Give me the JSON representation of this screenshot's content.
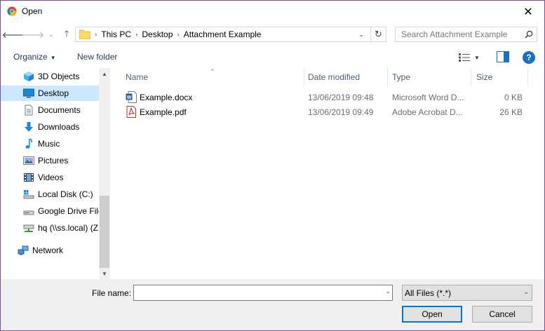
{
  "window": {
    "title": "Open",
    "close_glyph": "✕"
  },
  "nav_buttons": {
    "back": "🡐",
    "forward": "🡒",
    "recent": "⌄",
    "up": "🡑"
  },
  "address": {
    "crumbs": [
      "This PC",
      "Desktop",
      "Attachment Example"
    ],
    "separator": "›",
    "dropdown_glyph": "⌄",
    "refresh_glyph": "↻"
  },
  "search": {
    "placeholder": "Search Attachment Example"
  },
  "commands": {
    "organize": "Organize",
    "caret": "▼",
    "new_folder": "New folder",
    "view_caret": "▼",
    "help": "?"
  },
  "nav_pane": {
    "items": [
      {
        "label": "3D Objects",
        "icon": "3d-objects-icon"
      },
      {
        "label": "Desktop",
        "icon": "desktop-icon",
        "selected": true
      },
      {
        "label": "Documents",
        "icon": "documents-icon"
      },
      {
        "label": "Downloads",
        "icon": "downloads-icon"
      },
      {
        "label": "Music",
        "icon": "music-icon"
      },
      {
        "label": "Pictures",
        "icon": "pictures-icon"
      },
      {
        "label": "Videos",
        "icon": "videos-icon"
      },
      {
        "label": "Local Disk (C:)",
        "icon": "local-disk-icon"
      },
      {
        "label": "Google Drive File",
        "icon": "drive-icon"
      },
      {
        "label": "hq (\\\\ss.local) (Z",
        "icon": "network-drive-icon"
      },
      {
        "label": "Network",
        "icon": "network-icon"
      }
    ],
    "scroll_up": "▲",
    "scroll_down": "▼"
  },
  "file_list": {
    "columns": [
      "Name",
      "Date modified",
      "Type",
      "Size"
    ],
    "sort_glyph": "⌃",
    "rows": [
      {
        "name": "Example.docx",
        "date": "13/06/2019 09:48",
        "type": "Microsoft Word D...",
        "size": "0 KB",
        "icon": "word-doc-icon"
      },
      {
        "name": "Example.pdf",
        "date": "13/06/2019 09:49",
        "type": "Adobe Acrobat D...",
        "size": "26 KB",
        "icon": "pdf-icon"
      }
    ]
  },
  "bottom": {
    "file_name_label": "File name:",
    "file_name_value": "",
    "file_type": "All Files (*.*)",
    "caret": "⌄",
    "open": "Open",
    "cancel": "Cancel"
  },
  "colors": {
    "selection": "#cce8ff",
    "accent": "#0078d7",
    "help": "#1a6fc7"
  }
}
